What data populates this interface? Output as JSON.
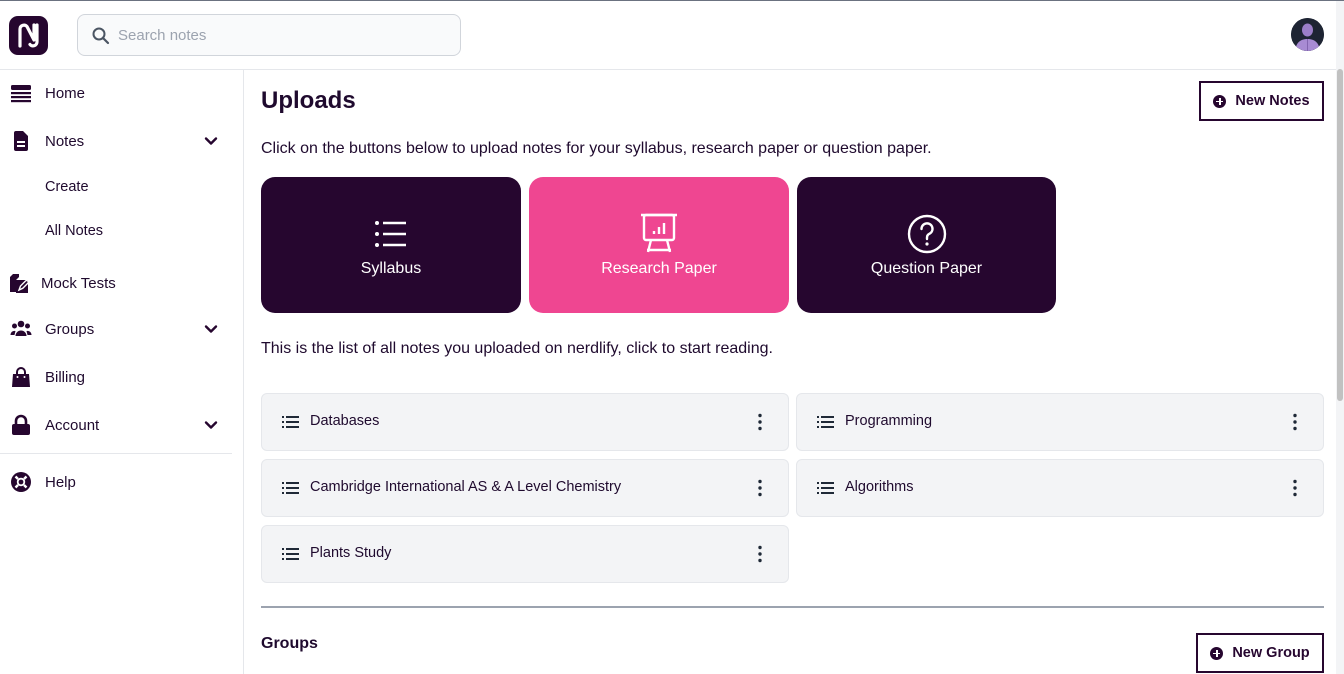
{
  "header": {
    "logo_icon": "nerdlify-logo-icon",
    "search": {
      "placeholder": "Search notes",
      "value": "",
      "icon": "search-icon"
    },
    "avatar_icon": "user-avatar-icon"
  },
  "sidebar": {
    "items": [
      {
        "label": "Home",
        "icon": "home-icon",
        "expandable": false
      },
      {
        "label": "Notes",
        "icon": "document-icon",
        "expandable": true,
        "children": [
          {
            "label": "Create"
          },
          {
            "label": "All Notes"
          }
        ]
      },
      {
        "label": "Mock Tests",
        "icon": "pencil-note-icon",
        "expandable": false
      },
      {
        "label": "Groups",
        "icon": "users-icon",
        "expandable": true
      },
      {
        "label": "Billing",
        "icon": "shopping-bag-icon",
        "expandable": false
      },
      {
        "label": "Account",
        "icon": "lock-icon",
        "expandable": true
      },
      {
        "label": "Help",
        "icon": "lifebuoy-icon",
        "expandable": false
      }
    ]
  },
  "main": {
    "title": "Uploads",
    "new_notes_label": "New Notes",
    "intro": "Click on the buttons below to upload notes for your syllabus, research paper or question paper.",
    "upload_cards": [
      {
        "label": "Syllabus",
        "icon": "list-icon",
        "color": "#26062f"
      },
      {
        "label": "Research Paper",
        "icon": "presentation-chart-icon",
        "color": "#ef4691"
      },
      {
        "label": "Question Paper",
        "icon": "question-circle-icon",
        "color": "#26062f"
      }
    ],
    "list_intro": "This is the list of all notes you uploaded on nerdlify, click to start reading.",
    "notes": [
      {
        "title": "Databases"
      },
      {
        "title": "Programming"
      },
      {
        "title": "Cambridge International AS & A Level Chemistry"
      },
      {
        "title": "Algorithms"
      },
      {
        "title": "Plants Study"
      }
    ],
    "groups_title": "Groups",
    "new_group_label": "New Group"
  },
  "colors": {
    "primary_dark": "#26062f",
    "accent_pink": "#ef4691",
    "note_bg": "#f3f4f6",
    "text": "#1f0a2e"
  }
}
